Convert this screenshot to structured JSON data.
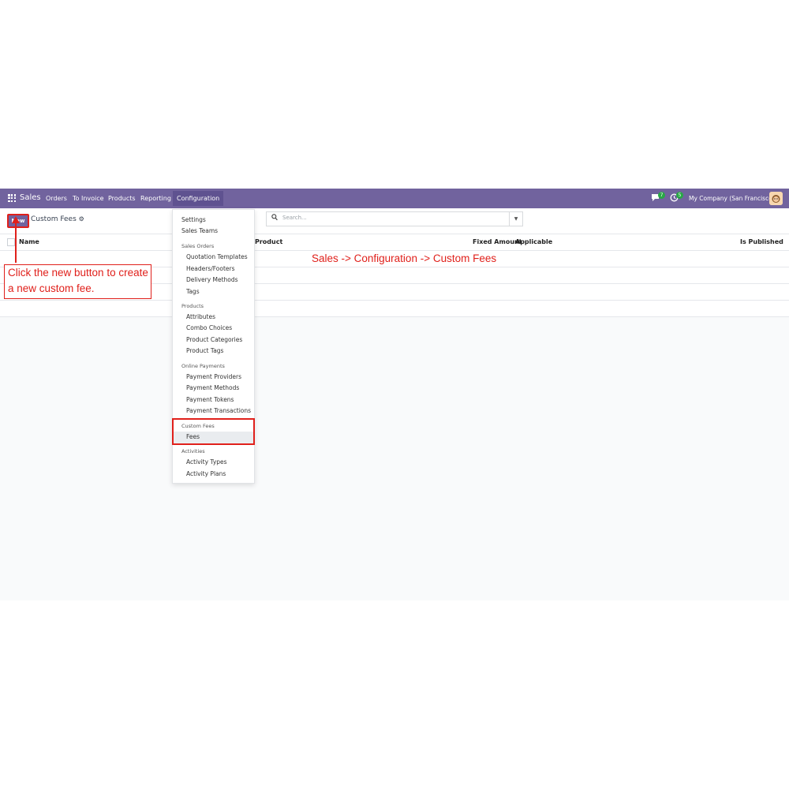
{
  "topbar": {
    "app_name": "Sales",
    "nav": [
      "Orders",
      "To Invoice",
      "Products",
      "Reporting",
      "Configuration"
    ],
    "messages_count": "7",
    "activities_count": "5",
    "company": "My Company (San Francisco)"
  },
  "controls": {
    "new_label": "New",
    "breadcrumb": "Custom Fees",
    "search_placeholder": "Search..."
  },
  "table": {
    "columns": [
      "Name",
      "Product",
      "Fixed Amount",
      "Applicable",
      "Is Published"
    ]
  },
  "menu": {
    "items": [
      {
        "label": "Settings",
        "kind": "item"
      },
      {
        "label": "Sales Teams",
        "kind": "item"
      },
      {
        "label": "Sales Orders",
        "kind": "header"
      },
      {
        "label": "Quotation Templates",
        "kind": "sub"
      },
      {
        "label": "Headers/Footers",
        "kind": "sub"
      },
      {
        "label": "Delivery Methods",
        "kind": "sub"
      },
      {
        "label": "Tags",
        "kind": "sub"
      },
      {
        "label": "Products",
        "kind": "header"
      },
      {
        "label": "Attributes",
        "kind": "sub"
      },
      {
        "label": "Combo Choices",
        "kind": "sub"
      },
      {
        "label": "Product Categories",
        "kind": "sub"
      },
      {
        "label": "Product Tags",
        "kind": "sub"
      },
      {
        "label": "Online Payments",
        "kind": "header"
      },
      {
        "label": "Payment Providers",
        "kind": "sub"
      },
      {
        "label": "Payment Methods",
        "kind": "sub"
      },
      {
        "label": "Payment Tokens",
        "kind": "sub"
      },
      {
        "label": "Payment Transactions",
        "kind": "sub"
      },
      {
        "label": "Custom Fees",
        "kind": "header"
      },
      {
        "label": "Fees",
        "kind": "sub"
      },
      {
        "label": "Activities",
        "kind": "header"
      },
      {
        "label": "Activity Types",
        "kind": "sub"
      },
      {
        "label": "Activity Plans",
        "kind": "sub"
      }
    ]
  },
  "annotations": {
    "path": "Sales -> Configuration -> Custom Fees",
    "callout_line1": "Click the new button to create",
    "callout_line2": "a new custom fee."
  },
  "colors": {
    "brand": "#71639e",
    "annotation": "#e0201b"
  }
}
